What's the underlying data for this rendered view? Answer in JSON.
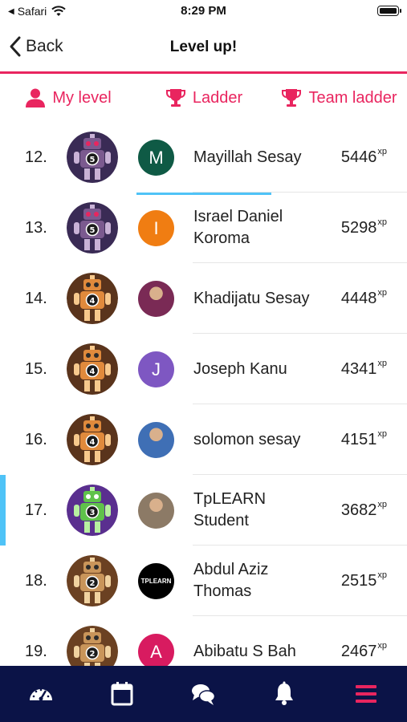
{
  "status_bar": {
    "carrier": "Safari",
    "time": "8:29 PM"
  },
  "nav": {
    "back_label": "Back",
    "title": "Level up!"
  },
  "tabs": [
    {
      "label": "My level",
      "icon": "person-icon"
    },
    {
      "label": "Ladder",
      "icon": "trophy-icon",
      "active": true
    },
    {
      "label": "Team ladder",
      "icon": "trophy-icon"
    }
  ],
  "colors": {
    "accent": "#e9255f",
    "active_underline": "#4fc3f7",
    "bottom_bar": "#0b1347"
  },
  "ladder": [
    {
      "rank": "12.",
      "level": "5",
      "avatar_letter": "M",
      "avatar_color": "#0f5a45",
      "name": "Mayillah Sesay",
      "xp": "5446",
      "xp_unit": "xp"
    },
    {
      "rank": "13.",
      "level": "5",
      "avatar_letter": "I",
      "avatar_color": "#f07d12",
      "name": "Israel Daniel Koroma",
      "xp": "5298",
      "xp_unit": "xp"
    },
    {
      "rank": "14.",
      "level": "4",
      "avatar_letter": "",
      "avatar_color": "#7a2a55",
      "name": "Khadijatu Sesay",
      "xp": "4448",
      "xp_unit": "xp"
    },
    {
      "rank": "15.",
      "level": "4",
      "avatar_letter": "J",
      "avatar_color": "#7e57c2",
      "name": "Joseph Kanu",
      "xp": "4341",
      "xp_unit": "xp"
    },
    {
      "rank": "16.",
      "level": "4",
      "avatar_letter": "",
      "avatar_color": "#3f6fb5",
      "name": "solomon sesay",
      "xp": "4151",
      "xp_unit": "xp"
    },
    {
      "rank": "17.",
      "level": "3",
      "avatar_letter": "",
      "avatar_color": "#8c7a66",
      "name": "TpLEARN Student",
      "xp": "3682",
      "xp_unit": "xp",
      "current_user": true
    },
    {
      "rank": "18.",
      "level": "2",
      "avatar_letter": "",
      "avatar_color": "#000000",
      "avatar_logo": "TPLEARN",
      "name": "Abdul Aziz Thomas",
      "xp": "2515",
      "xp_unit": "xp"
    },
    {
      "rank": "19.",
      "level": "2",
      "avatar_letter": "A",
      "avatar_color": "#d81b60",
      "name": "Abibatu S Bah",
      "xp": "2467",
      "xp_unit": "xp"
    }
  ],
  "bottom_nav": [
    {
      "icon": "dashboard-gauge-icon"
    },
    {
      "icon": "calendar-icon"
    },
    {
      "icon": "chat-bubbles-icon"
    },
    {
      "icon": "bell-icon"
    },
    {
      "icon": "menu-icon",
      "active": true
    }
  ]
}
